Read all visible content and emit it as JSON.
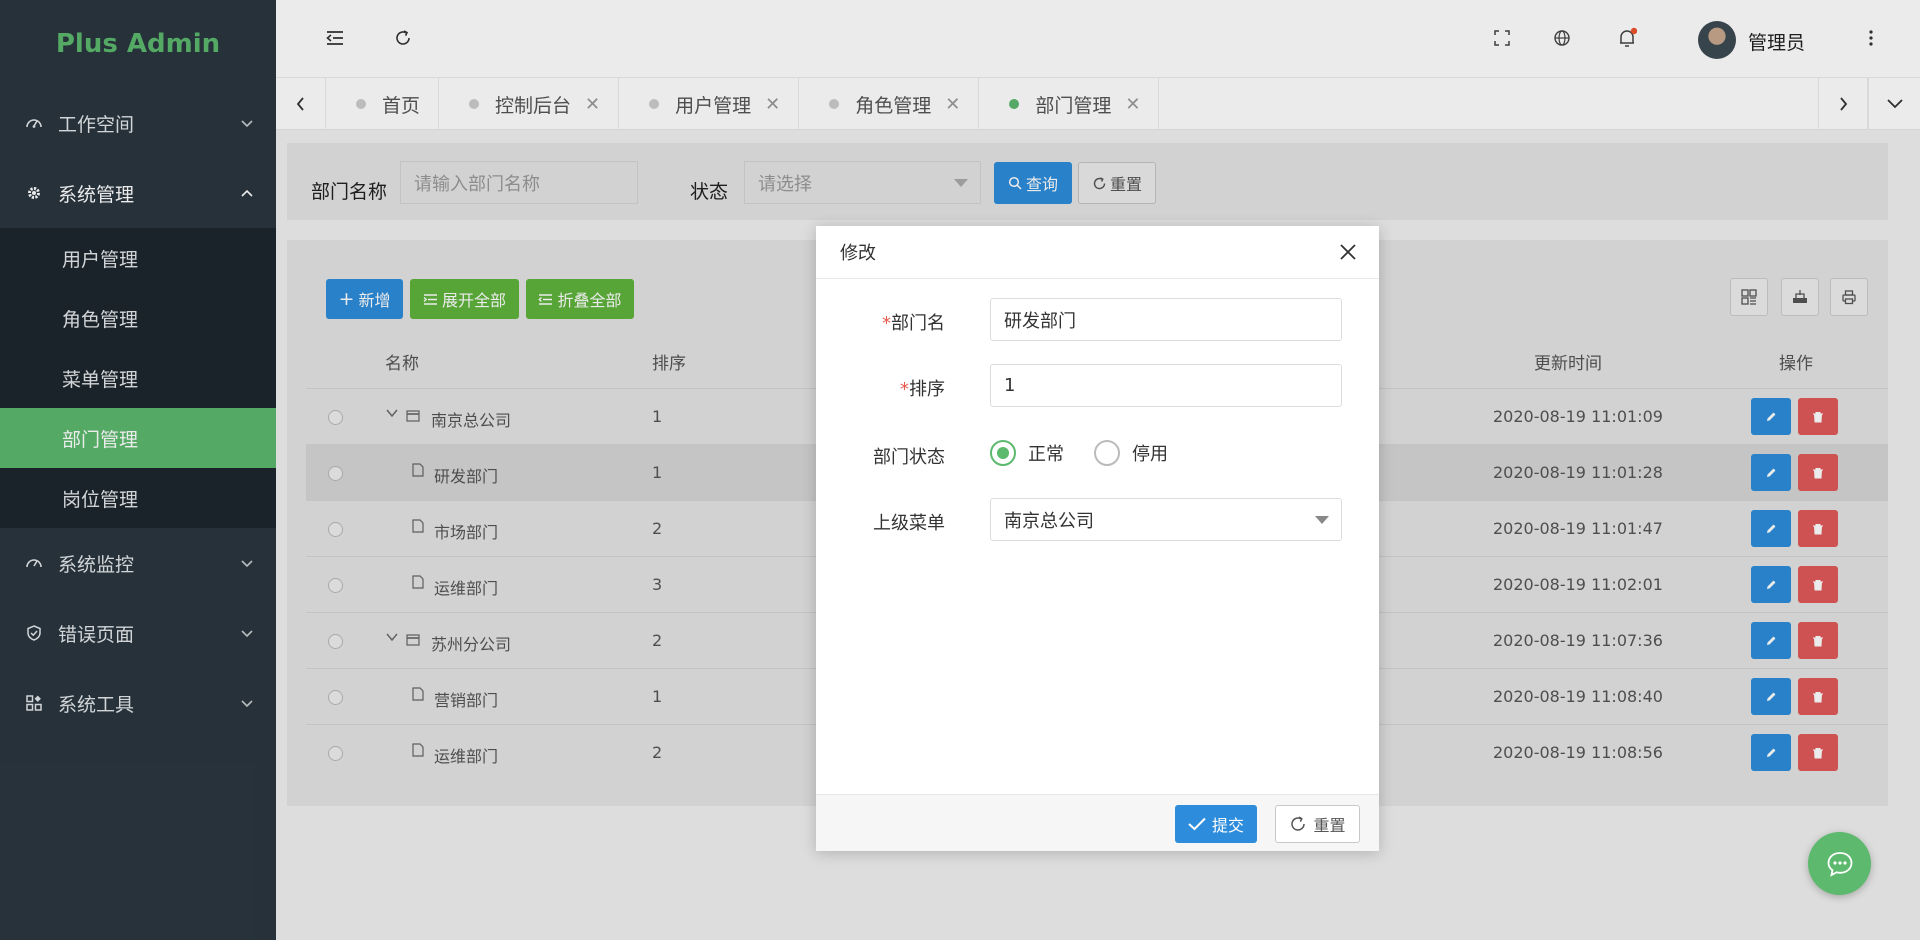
{
  "app": {
    "title": "Plus Admin"
  },
  "sidebar": {
    "items": [
      {
        "label": "工作空间"
      },
      {
        "label": "系统管理"
      },
      {
        "label": "系统监控"
      },
      {
        "label": "错误页面"
      },
      {
        "label": "系统工具"
      }
    ],
    "sub_items": [
      {
        "label": "用户管理"
      },
      {
        "label": "角色管理"
      },
      {
        "label": "菜单管理"
      },
      {
        "label": "部门管理"
      },
      {
        "label": "岗位管理"
      }
    ]
  },
  "header": {
    "user_name": "管理员"
  },
  "tabs": [
    {
      "label": "首页"
    },
    {
      "label": "控制后台"
    },
    {
      "label": "用户管理"
    },
    {
      "label": "角色管理"
    },
    {
      "label": "部门管理"
    }
  ],
  "search": {
    "dept_label": "部门名称",
    "dept_placeholder": "请输入部门名称",
    "status_label": "状态",
    "status_placeholder": "请选择",
    "query_label": "查询",
    "reset_label": "重置"
  },
  "toolbar": {
    "add_label": "新增",
    "expand_label": "展开全部",
    "collapse_label": "折叠全部"
  },
  "table": {
    "headers": {
      "name": "名称",
      "sort": "排序",
      "updated": "更新时间",
      "actions": "操作"
    },
    "rows": [
      {
        "name": "南京总公司",
        "sort": "1",
        "updated": "2020-08-19 11:01:09"
      },
      {
        "name": "研发部门",
        "sort": "1",
        "updated": "2020-08-19 11:01:28"
      },
      {
        "name": "市场部门",
        "sort": "2",
        "updated": "2020-08-19 11:01:47"
      },
      {
        "name": "运维部门",
        "sort": "3",
        "updated": "2020-08-19 11:02:01"
      },
      {
        "name": "苏州分公司",
        "sort": "2",
        "updated": "2020-08-19 11:07:36"
      },
      {
        "name": "营销部门",
        "sort": "1",
        "updated": "2020-08-19 11:08:40"
      },
      {
        "name": "运维部门",
        "sort": "2",
        "updated": "2020-08-19 11:08:56"
      }
    ]
  },
  "dialog": {
    "title": "修改",
    "name_label": "部门名",
    "name_value": "研发部门",
    "sort_label": "排序",
    "sort_value": "1",
    "status_label": "部门状态",
    "status_normal": "正常",
    "status_disabled": "停用",
    "parent_label": "上级菜单",
    "parent_value": "南京总公司",
    "submit_label": "提交",
    "reset_label": "重置"
  },
  "colors": {
    "brand": "#5cb96d",
    "sidebar": "#2a363f",
    "primary": "#2d8cdb",
    "danger": "#e05a5a",
    "success": "#5fb33c"
  }
}
